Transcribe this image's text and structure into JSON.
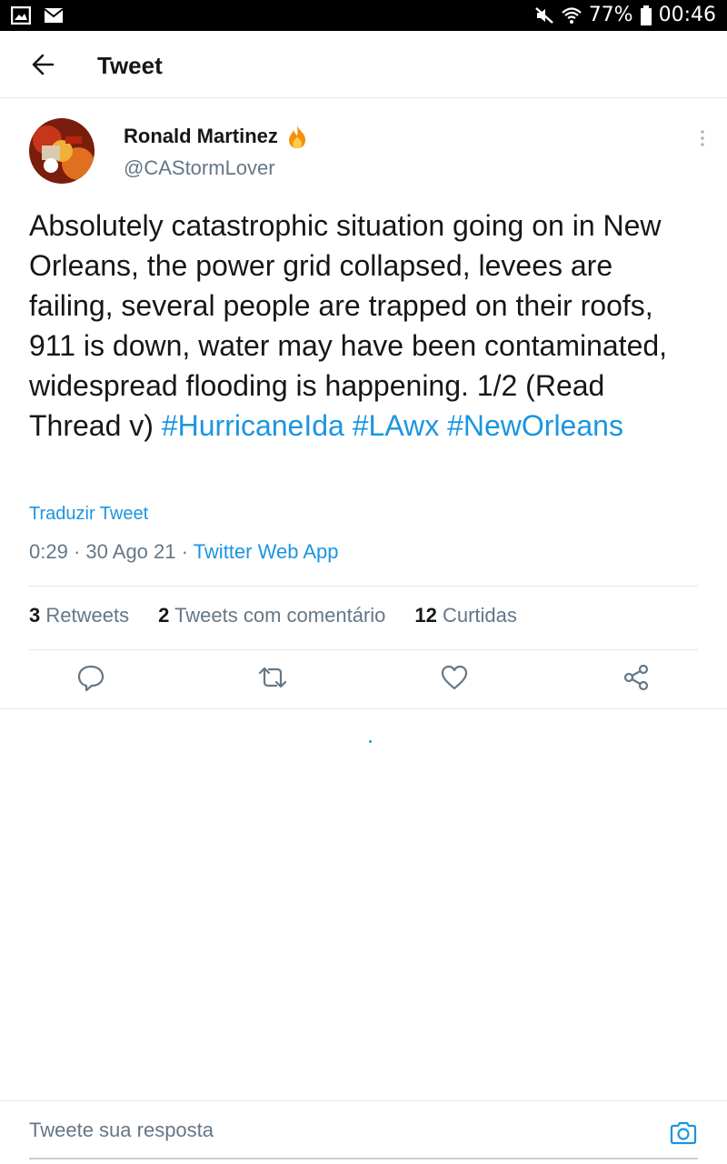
{
  "status_bar": {
    "battery": "77%",
    "time": "00:46",
    "icons": [
      "image-icon",
      "mail-icon",
      "mute-icon",
      "wifi-icon",
      "battery-icon"
    ]
  },
  "header": {
    "title": "Tweet",
    "back_icon": "arrow-left-icon"
  },
  "tweet": {
    "author_name": "Ronald Martinez",
    "author_handle": "@CAStormLover",
    "badge_icon": "fire-emoji",
    "text_plain": "Absolutely catastrophic situation going on in New Orleans, the power grid collapsed, levees are failing, several people are trapped on their roofs, 911 is down, water may have been contaminated, widespread flooding is happening. 1/2 (Read Thread v) ",
    "hashtags": [
      "#HurricaneIda",
      "#LAwx",
      "#NewOrleans"
    ],
    "translate_label": "Traduzir Tweet",
    "time": "0:29",
    "date": "30 Ago 21",
    "source": "Twitter Web App",
    "separator": "·"
  },
  "stats": {
    "retweets_count": "3",
    "retweets_label": "Retweets",
    "quotes_count": "2",
    "quotes_label": "Tweets com comentário",
    "likes_count": "12",
    "likes_label": "Curtidas"
  },
  "actions": [
    "reply-icon",
    "retweet-icon",
    "like-icon",
    "share-icon"
  ],
  "reply_bar": {
    "placeholder": "Tweete sua resposta",
    "camera_icon": "camera-icon"
  },
  "colors": {
    "accent": "#1b95e0",
    "text": "#14171a",
    "secondary": "#657786",
    "divider": "#e1e8ed"
  }
}
